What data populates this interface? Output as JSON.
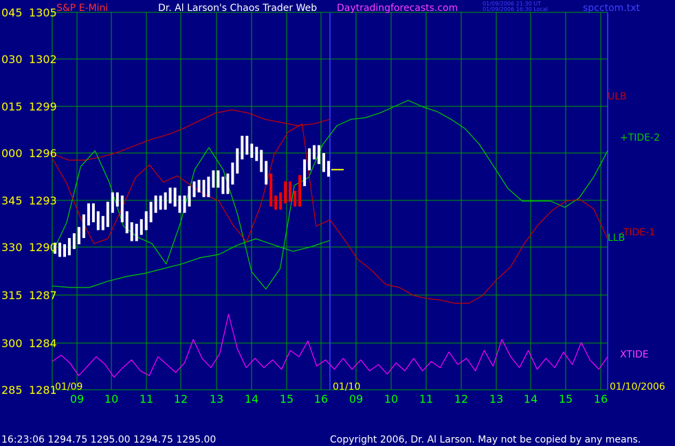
{
  "header": {
    "symbol": "S&P E-Mini",
    "title": "Dr. Al Larson's Chaos Trader Web",
    "site": "Daytradingforecasts.com",
    "stamp_ut": "01/09/2006 21:30 UT",
    "stamp_local": "01/09/2006 16:30 Local",
    "file": "spcctom.txt"
  },
  "footer": {
    "status": "16:23:06  1294.75 1295.00 1294.75 1295.00",
    "copyright": "Copyright 2006, Dr. Al Larson. May not be copied by any means."
  },
  "colors": {
    "background": "#000080",
    "grid": "#00a000",
    "price": "#ffffff",
    "price_highlight": "#ff0000",
    "forecast": "#ffff00",
    "ulb": "#cc0000",
    "llb": "#00cc00",
    "tide_plus2": "#00cc00",
    "tide_minus1": "#cc0000",
    "xtide": "#ff00ff",
    "now_line": "#4040ff"
  },
  "chart_data": {
    "type": "line",
    "ylabel_left": [
      "045",
      "030",
      "015",
      "000",
      "345",
      "330",
      "315",
      "300",
      "285"
    ],
    "ylabel_price": [
      "1305",
      "1302",
      "1299",
      "1296",
      "1293",
      "1290",
      "1287",
      "1284",
      "1281"
    ],
    "ylim": [
      1281,
      1305
    ],
    "x_ticks": [
      "09",
      "10",
      "11",
      "12",
      "13",
      "14",
      "15",
      "16",
      "09",
      "10",
      "11",
      "12",
      "13",
      "14",
      "15",
      "16"
    ],
    "date_labels": [
      "01/09",
      "01/10",
      "01/10/2006"
    ],
    "series_labels": [
      "ULB",
      "+TIDE-2",
      "LLB",
      "-TIDE-1",
      "XTIDE"
    ],
    "price_bars": [
      1290.0,
      1289.8,
      1289.9,
      1290.3,
      1290.6,
      1291.0,
      1291.8,
      1292.5,
      1292.0,
      1291.5,
      1291.7,
      1292.6,
      1293.2,
      1293.0,
      1292.0,
      1291.3,
      1290.8,
      1291.2,
      1291.5,
      1292.0,
      1292.6,
      1293.0,
      1292.8,
      1293.2,
      1293.5,
      1293.0,
      1292.6,
      1293.0,
      1293.6,
      1293.9,
      1294.0,
      1293.6,
      1294.2,
      1294.6,
      1294.2,
      1293.8,
      1294.4,
      1295.1,
      1296.0,
      1296.8,
      1296.3,
      1296.1,
      1295.9,
      1295.2,
      1294.4,
      1293.0,
      1292.8,
      1293.2,
      1293.9,
      1293.3,
      1293.0,
      1294.3,
      1295.3,
      1296.0,
      1296.2,
      1295.7,
      1295.2,
      1294.9
    ],
    "forecast_level": 1295.0,
    "ulb": [
      1296.0,
      1295.6,
      1295.6,
      1295.8,
      1296.1,
      1296.5,
      1296.9,
      1297.2,
      1297.6,
      1298.1,
      1298.6,
      1298.8,
      1298.6,
      1298.2,
      1298.0,
      1297.8,
      1297.9,
      1298.2
    ],
    "llb": [
      1287.6,
      1287.5,
      1287.5,
      1287.9,
      1288.2,
      1288.4,
      1288.7,
      1289.0,
      1289.4,
      1289.6,
      1290.2,
      1290.6,
      1290.2,
      1289.8,
      1290.1,
      1290.5
    ],
    "tide_plus2": [
      1289.7,
      1291.6,
      1295.2,
      1296.2,
      1294.2,
      1291.4,
      1290.7,
      1290.3,
      1289.0,
      1291.6,
      1295.0,
      1296.4,
      1295.0,
      1292.2,
      1288.5,
      1287.4,
      1288.7,
      1294.0,
      1294.5,
      1296.6,
      1297.8,
      1298.2,
      1298.3,
      1298.6,
      1299.0,
      1299.4,
      1299.0,
      1298.7,
      1298.2,
      1297.6,
      1296.6,
      1295.2,
      1293.8,
      1293.0,
      1293.0,
      1293.0,
      1292.6,
      1293.2,
      1294.5,
      1296.2
    ],
    "tide_minus1": [
      1295.7,
      1294.2,
      1292.0,
      1290.3,
      1290.6,
      1292.5,
      1294.5,
      1295.3,
      1294.2,
      1294.6,
      1294.0,
      1293.4,
      1293.0,
      1291.5,
      1290.4,
      1292.7,
      1296.0,
      1297.4,
      1297.9,
      1291.4,
      1291.8,
      1290.6,
      1289.3,
      1288.6,
      1287.7,
      1287.5,
      1287.0,
      1286.8,
      1286.7,
      1286.5,
      1286.5,
      1287.0,
      1288.0,
      1288.8,
      1290.3,
      1291.5,
      1292.4,
      1293.0,
      1293.1,
      1292.5,
      1290.6
    ],
    "xtide": [
      1282.8,
      1283.2,
      1282.7,
      1281.9,
      1282.5,
      1283.1,
      1282.6,
      1281.8,
      1282.4,
      1282.9,
      1282.2,
      1281.9,
      1283.1,
      1282.6,
      1282.1,
      1282.7,
      1284.2,
      1283.0,
      1282.4,
      1283.3,
      1285.8,
      1283.6,
      1282.4,
      1283.0,
      1282.4,
      1282.9,
      1282.3,
      1283.5,
      1283.1,
      1284.1,
      1282.5,
      1282.9,
      1282.3,
      1283.0,
      1282.3,
      1282.9,
      1282.2,
      1282.6,
      1282.0,
      1282.7,
      1282.2,
      1283.0,
      1282.2,
      1282.8,
      1282.4,
      1283.4,
      1282.6,
      1283.0,
      1282.2,
      1283.5,
      1282.5,
      1284.2,
      1283.1,
      1282.4,
      1283.5,
      1282.3,
      1283.0,
      1282.4,
      1283.4,
      1282.6,
      1284.0,
      1282.9,
      1282.3,
      1283.1
    ]
  }
}
